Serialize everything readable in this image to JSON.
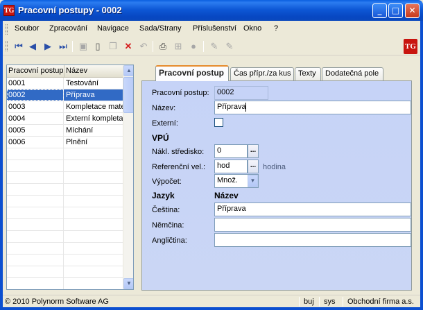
{
  "window": {
    "title": "Pracovní postupy - 0002",
    "logo": "TG"
  },
  "menu": [
    "Soubor",
    "Zpracování",
    "Navigace",
    "Sada/Strany",
    "Příslušenství",
    "Okno",
    "?"
  ],
  "toolbar": {
    "icons": [
      "first-record-icon",
      "previous-record-icon",
      "next-record-icon",
      "last-record-icon",
      "save-icon",
      "new-record-icon",
      "copy-icon",
      "delete-icon",
      "undo-icon",
      "print-icon",
      "tree-icon",
      "stop-icon",
      "edit-icon",
      "edit-disabled-icon"
    ]
  },
  "list": {
    "headers": [
      "Pracovní postup",
      "Název"
    ],
    "rows": [
      {
        "code": "0001",
        "name": "Testování"
      },
      {
        "code": "0002",
        "name": "Příprava"
      },
      {
        "code": "0003",
        "name": "Kompletace mate"
      },
      {
        "code": "0004",
        "name": "Externí kompletac"
      },
      {
        "code": "0005",
        "name": "Míchání"
      },
      {
        "code": "0006",
        "name": "Plnění"
      }
    ],
    "selected_index": 1
  },
  "tabs": [
    "Pracovní postup",
    "Čas přípr./za kus",
    "Texty",
    "Dodatečná pole"
  ],
  "active_tab": 0,
  "form": {
    "code_label": "Pracovní postup:",
    "code_value": "0002",
    "name_label": "Název:",
    "name_value": "Příprava",
    "external_label": "Externí:",
    "external_checked": false,
    "vpu_heading": "VPÚ",
    "cost_center_label": "Nákl. středisko:",
    "cost_center_value": "0",
    "ref_qty_label": "Referenční vel.:",
    "ref_qty_value": "hod",
    "ref_qty_unit": "hodina",
    "calc_label": "Výpočet:",
    "calc_value": "Množ.",
    "lang_heading": "Jazyk",
    "lang_name_heading": "Název",
    "languages": [
      {
        "label": "Čeština:",
        "value": "Příprava"
      },
      {
        "label": "Němčina:",
        "value": ""
      },
      {
        "label": "Angličtina:",
        "value": ""
      }
    ],
    "ellipsis": "..."
  },
  "status": {
    "copyright": "© 2010 Polynorm Software AG",
    "user": "buj",
    "db": "sys",
    "company": "Obchodní firma a.s."
  }
}
